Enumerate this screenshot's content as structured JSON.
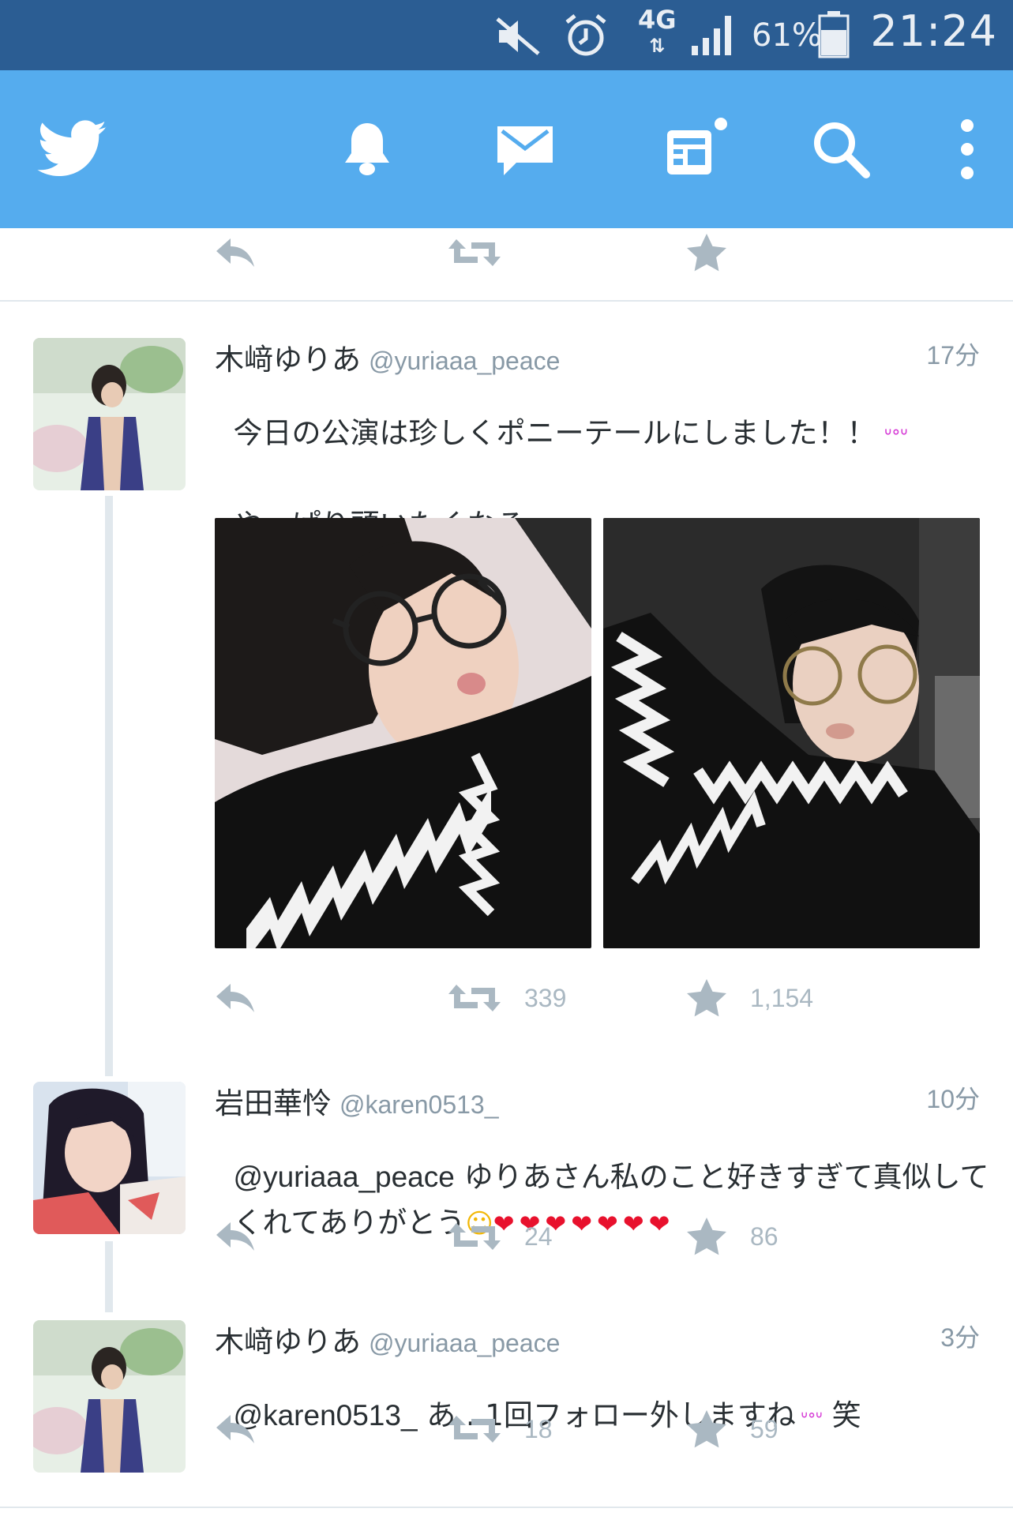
{
  "status_bar": {
    "network": "4G",
    "battery": "61%",
    "time": "21:24"
  },
  "tabs": [
    {
      "icon": "twitter-bird-icon",
      "label": "Home"
    },
    {
      "icon": "bell-icon",
      "label": "Notifications"
    },
    {
      "icon": "mail-icon",
      "label": "Messages"
    },
    {
      "icon": "news-icon",
      "label": "Moments"
    },
    {
      "icon": "search-icon",
      "label": "Search"
    },
    {
      "icon": "more-vertical-icon",
      "label": "More"
    }
  ],
  "tweets": [
    {
      "name": "木﨑ゆりあ",
      "handle": "@yuriaaa_peace",
      "time": "17分",
      "text_line1": "今日の公演は珍しくポニーテールにしました！！",
      "text_line2": "やっぱり頭いたくなるー",
      "retweets": "339",
      "likes": "1,154"
    },
    {
      "name": "岩田華怜",
      "handle": "@karen0513_",
      "time": "10分",
      "mention": "@yuriaaa_peace",
      "text_line1": " ゆりあさん私のこと好きすぎて真似して",
      "text_line2": "くれてありがとう",
      "retweets": "24",
      "likes": "86"
    },
    {
      "name": "木﨑ゆりあ",
      "handle": "@yuriaaa_peace",
      "time": "3分",
      "mention": "@karen0513_",
      "text_line1": " あ…1回フォロー外しますね",
      "text_suffix": " 笑",
      "retweets": "18",
      "likes": "59"
    }
  ],
  "colors": {
    "status_bar": "#2b5d93",
    "app_bar": "#55acee",
    "action_grey": "#aab8c2",
    "emoji_pink": "#d63bd6",
    "heart_red": "#e8112d"
  }
}
